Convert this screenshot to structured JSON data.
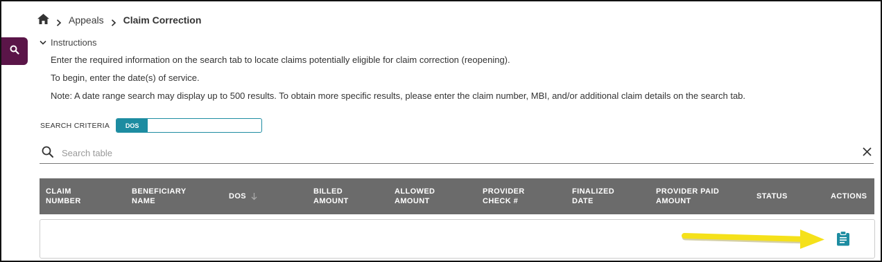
{
  "breadcrumb": {
    "home_icon": "home-icon",
    "items": [
      "Appeals",
      "Claim Correction"
    ]
  },
  "sidebar": {
    "search_icon": "search-icon",
    "accent": "#5a1548"
  },
  "instructions": {
    "toggle_label": "Instructions",
    "lines": [
      "Enter the required information on the search tab to locate claims potentially eligible for claim correction (reopening).",
      "To begin, enter the date(s) of service.",
      "Note: A date range search may display up to 500 results. To obtain more specific results, please enter the claim number, MBI, and/or additional claim details on the search tab."
    ]
  },
  "search_criteria": {
    "label": "SEARCH CRITERIA",
    "active_option": "DOS",
    "accent": "#1d8ca1"
  },
  "table_search": {
    "placeholder": "Search table"
  },
  "table": {
    "columns": [
      {
        "line1": "CLAIM",
        "line2": "NUMBER"
      },
      {
        "line1": "BENEFICIARY",
        "line2": "NAME"
      },
      {
        "line1": "DOS",
        "line2": ""
      },
      {
        "line1": "BILLED",
        "line2": "AMOUNT"
      },
      {
        "line1": "ALLOWED",
        "line2": "AMOUNT"
      },
      {
        "line1": "PROVIDER",
        "line2": "CHECK #"
      },
      {
        "line1": "FINALIZED",
        "line2": "DATE"
      },
      {
        "line1": "PROVIDER PAID",
        "line2": "AMOUNT"
      },
      {
        "line1": "STATUS",
        "line2": ""
      },
      {
        "line1": "ACTIONS",
        "line2": ""
      }
    ],
    "header_bg": "#6b6b6b",
    "sort_column": "DOS",
    "sort_direction": "descending",
    "rows": [
      {
        "action_icon": "clipboard-icon"
      }
    ]
  },
  "annotation": {
    "arrow_color": "#f5e11a",
    "points_to": "clipboard-icon"
  }
}
